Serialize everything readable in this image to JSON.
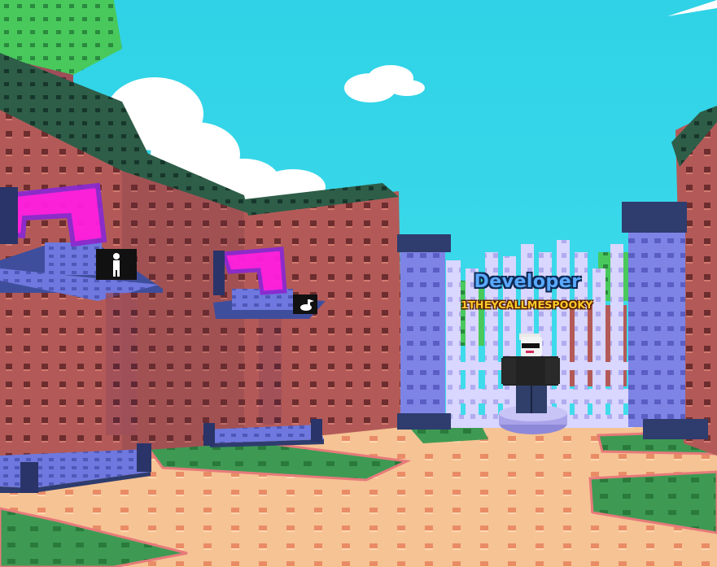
{
  "scene": {
    "sky_color": "#33d6e8",
    "wall_color": "#b45a5a",
    "wall_top_color": "#2c5a45",
    "floor_color": "#f3be8f",
    "grass_color": "#3d9a52",
    "portal_color": "#ff24e6",
    "pillar_color": "#7f83e8",
    "fence_color": "#d6d6ff"
  },
  "pads": [
    {
      "icon": "person-icon"
    },
    {
      "icon": "goose-icon"
    }
  ],
  "npc": {
    "title": "Developer",
    "player_name": "1THEYCALLMESPOOKY"
  }
}
